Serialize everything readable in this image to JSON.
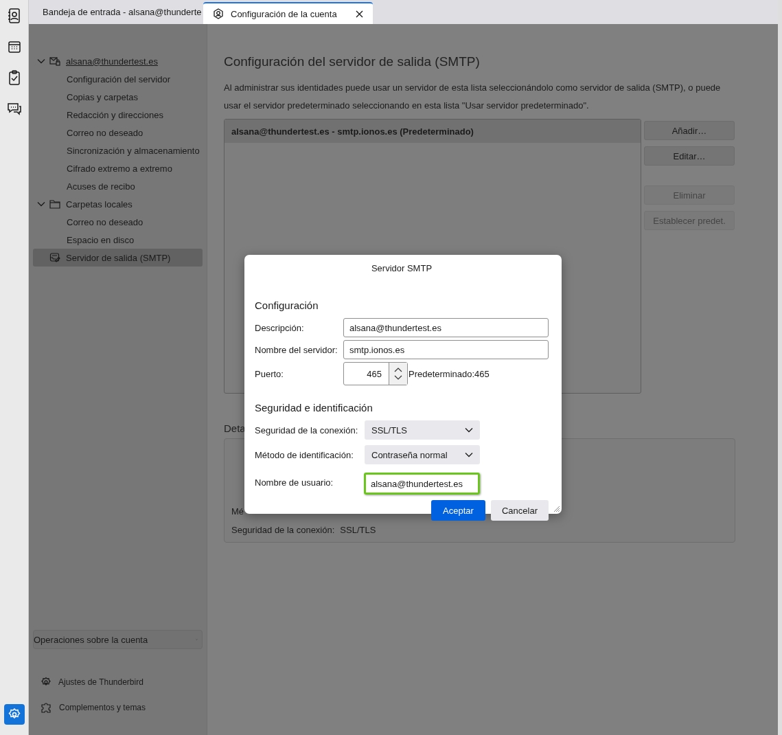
{
  "rail": [
    {
      "kind": "address-book",
      "selected": false
    },
    {
      "kind": "calendar",
      "selected": false
    },
    {
      "kind": "tasks",
      "selected": false
    },
    {
      "kind": "chat",
      "selected": false
    },
    {
      "kind": "settings",
      "selected": true
    }
  ],
  "tabs": [
    {
      "kind": "inbox",
      "label": "Bandeja de entrada - alsana@thunderte",
      "selected": false
    },
    {
      "kind": "account",
      "label": "Configuración de la cuenta",
      "selected": true
    }
  ],
  "sidebar": {
    "tree": [
      {
        "kind": "account",
        "label": "alsana@thundertest.es",
        "expanded": true,
        "selected": false,
        "children": [
          {
            "label": "Configuración del servidor",
            "selected": false
          },
          {
            "label": "Copias y carpetas",
            "selected": false
          },
          {
            "label": "Redacción y direcciones",
            "selected": false
          },
          {
            "label": "Correo no deseado",
            "selected": false
          },
          {
            "label": "Sincronización y almacenamiento",
            "selected": false
          },
          {
            "label": "Cifrado extremo a extremo",
            "selected": false
          },
          {
            "label": "Acuses de recibo",
            "selected": false
          }
        ]
      },
      {
        "kind": "folder",
        "label": "Carpetas locales",
        "expanded": true,
        "selected": false,
        "children": [
          {
            "label": "Correo no deseado",
            "selected": false
          },
          {
            "label": "Espacio en disco",
            "selected": false
          }
        ]
      },
      {
        "kind": "smtp",
        "label": "Servidor de salida (SMTP)",
        "selected": true
      }
    ],
    "account_actions": "Operaciones sobre la cuenta",
    "footer": [
      {
        "kind": "settings",
        "label": "Ajustes de Thunderbird"
      },
      {
        "kind": "addons",
        "label": "Complementos y temas"
      }
    ]
  },
  "content": {
    "title": "Configuración del servidor de salida (SMTP)",
    "description": "Al administrar sus identidades puede usar un servidor de esta lista seleccionándolo como servidor de salida (SMTP), o puede usar el servidor predeterminado seleccionando en esta lista \"Usar servidor predeterminado\".",
    "servers": [
      {
        "text": "alsana@thundertest.es - smtp.ionos.es (Predeterminado)",
        "selected": true
      }
    ],
    "buttons": [
      {
        "label": "Añadir…",
        "disabled": false
      },
      {
        "label": "Editar…",
        "disabled": false
      },
      {
        "label": "Eliminar",
        "disabled": true
      },
      {
        "label": "Establecer predet.",
        "disabled": true
      }
    ],
    "details": {
      "title": "Deta",
      "rows": [
        {
          "label": "Mé"
        },
        {
          "label": "Seguridad de la conexión:",
          "value": "SSL/TLS"
        }
      ]
    }
  },
  "dialog": {
    "title": "Servidor SMTP",
    "sections": [
      {
        "heading": "Configuración",
        "fields": [
          {
            "kind": "text",
            "label": "Descripción:",
            "value": "alsana@thundertest.es",
            "highlighted": false
          },
          {
            "kind": "text",
            "label": "Nombre del servidor:",
            "value": "smtp.ionos.es",
            "highlighted": false
          },
          {
            "kind": "number",
            "label": "Puerto:",
            "value": "465",
            "hint": "Predeterminado:465"
          }
        ]
      },
      {
        "heading": "Seguridad e identificación",
        "fields": [
          {
            "kind": "select",
            "label": "Seguridad de la conexión:",
            "value": "SSL/TLS"
          },
          {
            "kind": "select",
            "label": "Método de identificación:",
            "value": "Contraseña normal"
          },
          {
            "kind": "text",
            "label": "Nombre de usuario:",
            "value": "alsana@thundertest.es",
            "highlighted": true
          }
        ]
      }
    ],
    "buttons": [
      {
        "kind": "primary",
        "label": "Aceptar"
      },
      {
        "kind": "secondary",
        "label": "Cancelar"
      }
    ]
  }
}
